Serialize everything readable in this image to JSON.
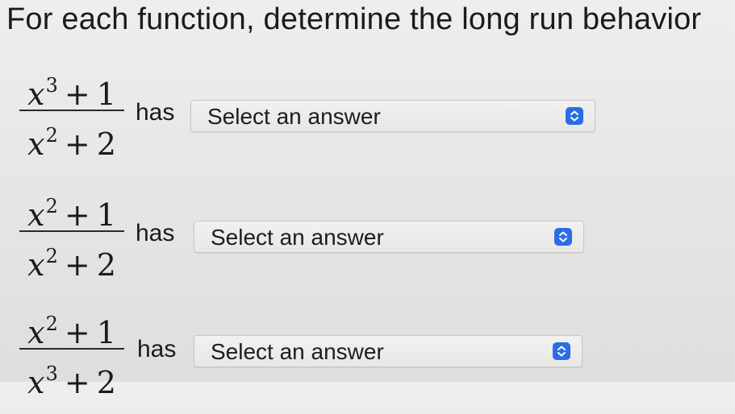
{
  "instruction": "For each function, determine the long run behavior",
  "problems": [
    {
      "numerator": {
        "variable": "x",
        "exponent": "3",
        "operator": "+",
        "constant": "1"
      },
      "denominator": {
        "variable": "x",
        "exponent": "2",
        "operator": "+",
        "constant": "2"
      },
      "has_label": "has",
      "select_value": "Select an answer"
    },
    {
      "numerator": {
        "variable": "x",
        "exponent": "2",
        "operator": "+",
        "constant": "1"
      },
      "denominator": {
        "variable": "x",
        "exponent": "2",
        "operator": "+",
        "constant": "2"
      },
      "has_label": "has",
      "select_value": "Select an answer"
    },
    {
      "numerator": {
        "variable": "x",
        "exponent": "2",
        "operator": "+",
        "constant": "1"
      },
      "denominator": {
        "variable": "x",
        "exponent": "3",
        "operator": "+",
        "constant": "2"
      },
      "has_label": "has",
      "select_value": "Select an answer"
    }
  ],
  "icons": {
    "select_icon": "up-down-chevron-icon"
  },
  "colors": {
    "select_icon_background": "#2a6ee6",
    "text": "#1b1b1b"
  }
}
